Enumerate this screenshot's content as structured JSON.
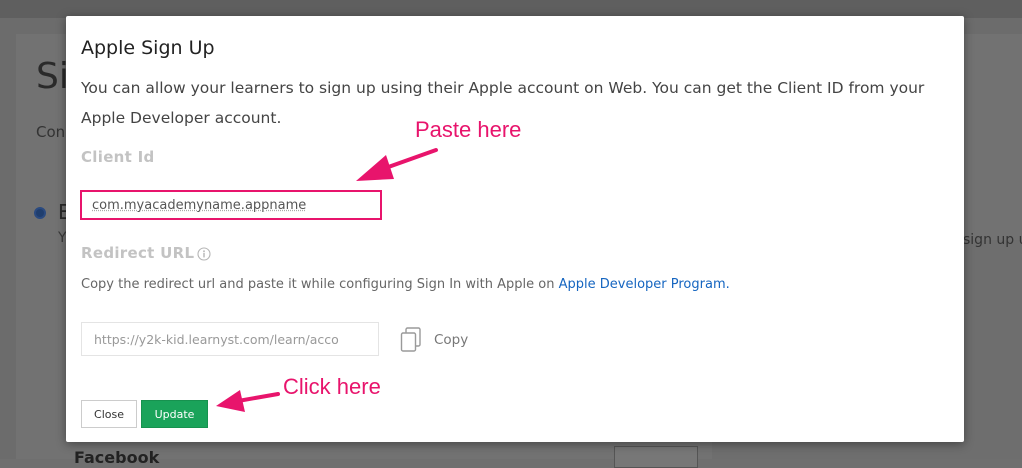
{
  "background": {
    "title": "Si",
    "subtitle": "Con",
    "option_label": "E",
    "option_desc": "Y",
    "right_text": "sign up u",
    "facebook_label": "Facebook"
  },
  "modal": {
    "title": "Apple Sign Up",
    "description": "You can allow your learners to sign up using their Apple account on Web. You can get the Client ID from your Apple Developer account.",
    "client_id": {
      "label": "Client Id",
      "value": "com.myacademyname.appname"
    },
    "redirect_url": {
      "label": "Redirect URL",
      "description": "Copy the redirect url and paste it while configuring Sign In with Apple on",
      "link_text": "Apple Developer Program.",
      "value": "https://y2k-kid.learnyst.com/learn/acco",
      "copy_label": "Copy"
    },
    "buttons": {
      "close_label": "Close",
      "update_label": "Update"
    }
  },
  "annotations": {
    "paste_here": "Paste here",
    "click_here": "Click here",
    "color": "#e8146c"
  },
  "colors": {
    "accent_green": "#1aa35a",
    "link_blue": "#1565c0",
    "highlight_pink": "#e8146c"
  },
  "icons": {
    "info": "info-circle-icon",
    "copy": "copy-icon"
  }
}
